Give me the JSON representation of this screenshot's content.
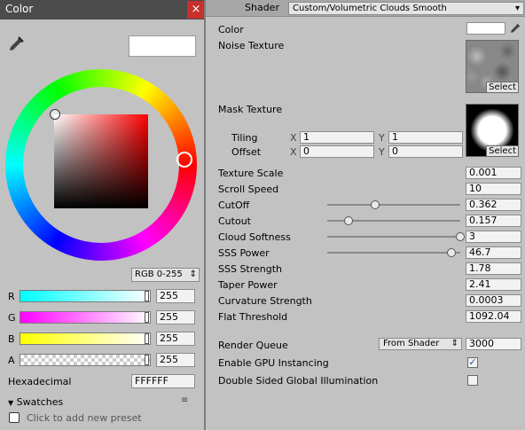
{
  "color_window": {
    "title": "Color",
    "close_glyph": "×",
    "preview_color": "#ffffff",
    "mode": "RGB 0-255",
    "mode_arrow": "⇕",
    "channels": [
      {
        "label": "R",
        "value": "255"
      },
      {
        "label": "G",
        "value": "255"
      },
      {
        "label": "B",
        "value": "255"
      },
      {
        "label": "A",
        "value": "255"
      }
    ],
    "hex_label": "Hexadecimal",
    "hex_value": "FFFFFF",
    "swatches_label": "Swatches",
    "swatches_toggle_glyph": "▼",
    "swatches_menu_glyph": "≡",
    "preset_text": "Click to add new preset"
  },
  "inspector": {
    "shader_label": "Shader",
    "shader_value": "Custom/Volumetric Clouds Smooth",
    "shader_arrow": "▾",
    "color_label": "Color",
    "color_value": "#ffffff",
    "noise_texture_label": "Noise Texture",
    "mask_texture_label": "Mask Texture",
    "select_label": "Select",
    "tiling_label": "Tiling",
    "offset_label": "Offset",
    "x_label": "X",
    "y_label": "Y",
    "tiling_x": "1",
    "tiling_y": "1",
    "offset_x": "0",
    "offset_y": "0",
    "properties": [
      {
        "label": "Texture Scale",
        "value": "0.001"
      },
      {
        "label": "Scroll Speed",
        "value": "10"
      },
      {
        "label": "CutOff",
        "value": "0.362",
        "slider": 0.362
      },
      {
        "label": "Cutout",
        "value": "0.157",
        "slider": 0.157
      },
      {
        "label": "Cloud Softness",
        "value": "3",
        "slider": 1.0
      },
      {
        "label": "SSS Power",
        "value": "46.7",
        "slider": 0.934
      },
      {
        "label": "SSS Strength",
        "value": "1.78"
      },
      {
        "label": "Taper Power",
        "value": "2.41"
      },
      {
        "label": "Curvature Strength",
        "value": "0.0003"
      },
      {
        "label": "Flat Threshold",
        "value": "1092.04"
      }
    ],
    "render_queue_label": "Render Queue",
    "render_queue_mode": "From Shader",
    "render_queue_arrow": "⇕",
    "render_queue_value": "3000",
    "gpu_instancing_label": "Enable GPU Instancing",
    "gpu_instancing_checked": true,
    "gpu_instancing_mark": "✓",
    "double_sided_label": "Double Sided Global Illumination",
    "double_sided_checked": false
  }
}
